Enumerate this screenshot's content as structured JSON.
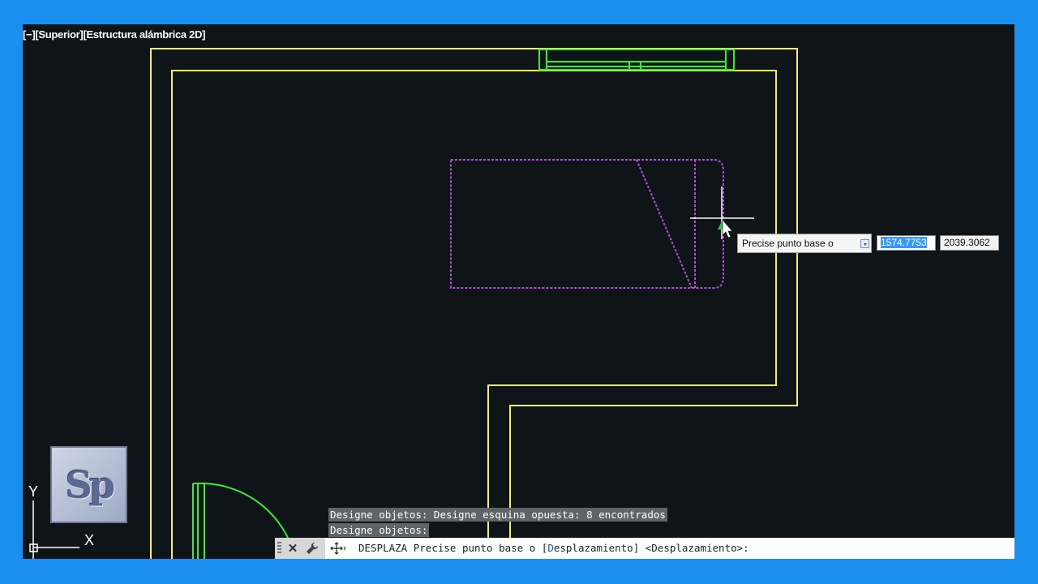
{
  "viewport": {
    "label": "[−][Superior][Estructura alámbrica 2D]"
  },
  "colors": {
    "walls": "#f0f060",
    "windows_doors": "#33ee33",
    "selected_object": "#b050d0",
    "background": "#0e1418",
    "frame": "#1a8fef"
  },
  "tooltip": {
    "prompt": "Precise punto base o",
    "x_value": "1574.7753",
    "y_value": "2039.3062",
    "dropdown_icon": "down-arrow-icon"
  },
  "command_history": [
    "Designe objetos: Designe esquina opuesta: 8 encontrados",
    "Designe objetos:"
  ],
  "command_line": {
    "command": "DESPLAZA",
    "prompt_before": " Precise punto base o [",
    "option_hotkey": "D",
    "option_rest": "esplazamiento",
    "prompt_after": "] <Desplazamiento>:",
    "close_icon": "close-icon",
    "settings_icon": "wrench-icon",
    "command_icon": "move-arrows-icon"
  },
  "ucs": {
    "x_label": "X",
    "y_label": "Y"
  },
  "logo": {
    "text": "Sp"
  }
}
